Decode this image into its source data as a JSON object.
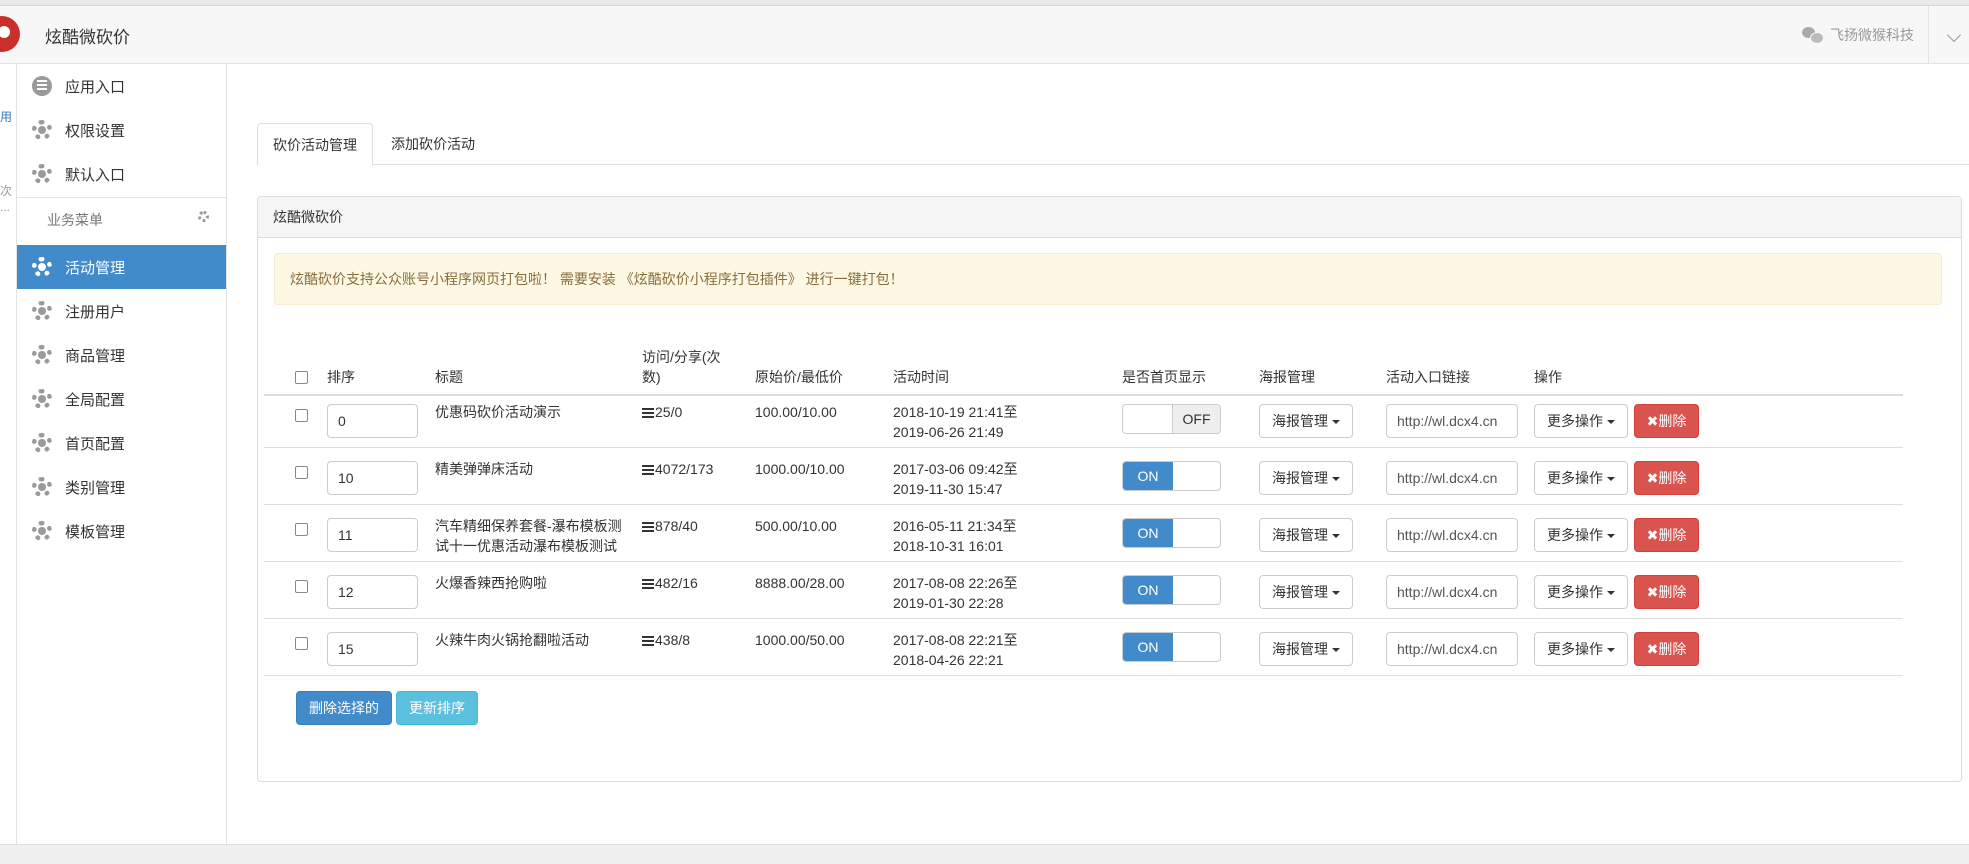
{
  "header": {
    "app_title": "炫酷微砍价",
    "company": "飞扬微猴科技"
  },
  "edge": [
    "用",
    "次",
    "..."
  ],
  "sidebar": {
    "top_items": [
      {
        "label": "应用入口",
        "icon": "chat-icon"
      },
      {
        "label": "权限设置",
        "icon": "gear-icon"
      },
      {
        "label": "默认入口",
        "icon": "gear-icon"
      }
    ],
    "menu_header": "业务菜单",
    "items": [
      {
        "label": "活动管理",
        "active": true
      },
      {
        "label": "注册用户"
      },
      {
        "label": "商品管理"
      },
      {
        "label": "全局配置"
      },
      {
        "label": "首页配置"
      },
      {
        "label": "类别管理"
      },
      {
        "label": "模板管理"
      }
    ]
  },
  "tabs": [
    {
      "label": "砍价活动管理",
      "active": true
    },
    {
      "label": "添加砍价活动"
    }
  ],
  "panel": {
    "title": "炫酷微砍价",
    "alert": "炫酷砍价支持公众账号小程序网页打包啦！  需要安装 《炫酷砍价小程序打包插件》 进行一键打包！"
  },
  "table": {
    "headers": {
      "sort": "排序",
      "title": "标题",
      "visits_1": "访问/分享(次",
      "visits_2": "数)",
      "price": "原始价/最低价",
      "time": "活动时间",
      "homepage": "是否首页显示",
      "poster": "海报管理",
      "link": "活动入口链接",
      "ops": "操作"
    },
    "rows": [
      {
        "sort": "0",
        "title_1": "优惠码砍价活动演示",
        "title_2": "",
        "visits": "25/0",
        "price": "100.00/10.00",
        "time_1": "2018-10-19 21:41至",
        "time_2": "2019-06-26 21:49",
        "homepage": "OFF",
        "poster": "海报管理",
        "link": "http://wl.dcx4.cn",
        "more": "更多操作",
        "delete": "✖删除"
      },
      {
        "sort": "10",
        "title_1": "精美弹弹床活动",
        "title_2": "",
        "visits": "4072/173",
        "price": "1000.00/10.00",
        "time_1": "2017-03-06 09:42至",
        "time_2": "2019-11-30 15:47",
        "homepage": "ON",
        "poster": "海报管理",
        "link": "http://wl.dcx4.cn",
        "more": "更多操作",
        "delete": "✖删除"
      },
      {
        "sort": "11",
        "title_1": "汽车精细保养套餐-瀑布模板测",
        "title_2": "试十一优惠活动瀑布模板测试",
        "visits": "878/40",
        "price": "500.00/10.00",
        "time_1": "2016-05-11 21:34至",
        "time_2": "2018-10-31 16:01",
        "homepage": "ON",
        "poster": "海报管理",
        "link": "http://wl.dcx4.cn",
        "more": "更多操作",
        "delete": "✖删除"
      },
      {
        "sort": "12",
        "title_1": "火爆香辣西抢购啦",
        "title_2": "",
        "visits": "482/16",
        "price": "8888.00/28.00",
        "time_1": "2017-08-08 22:26至",
        "time_2": "2019-01-30 22:28",
        "homepage": "ON",
        "poster": "海报管理",
        "link": "http://wl.dcx4.cn",
        "more": "更多操作",
        "delete": "✖删除"
      },
      {
        "sort": "15",
        "title_1": "火辣牛肉火锅抢翻啦活动",
        "title_2": "",
        "visits": "438/8",
        "price": "1000.00/50.00",
        "time_1": "2017-08-08 22:21至",
        "time_2": "2018-04-26 22:21",
        "homepage": "ON",
        "poster": "海报管理",
        "link": "http://wl.dcx4.cn",
        "more": "更多操作",
        "delete": "✖删除"
      }
    ],
    "actions": {
      "delete_selected": "删除选择的",
      "update_sort": "更新排序"
    }
  },
  "colors": {
    "primary": "#428bca",
    "danger": "#d9534f",
    "info": "#5bc0de",
    "alert_bg": "#fcf8e3",
    "alert_text": "#8a6d3b"
  }
}
